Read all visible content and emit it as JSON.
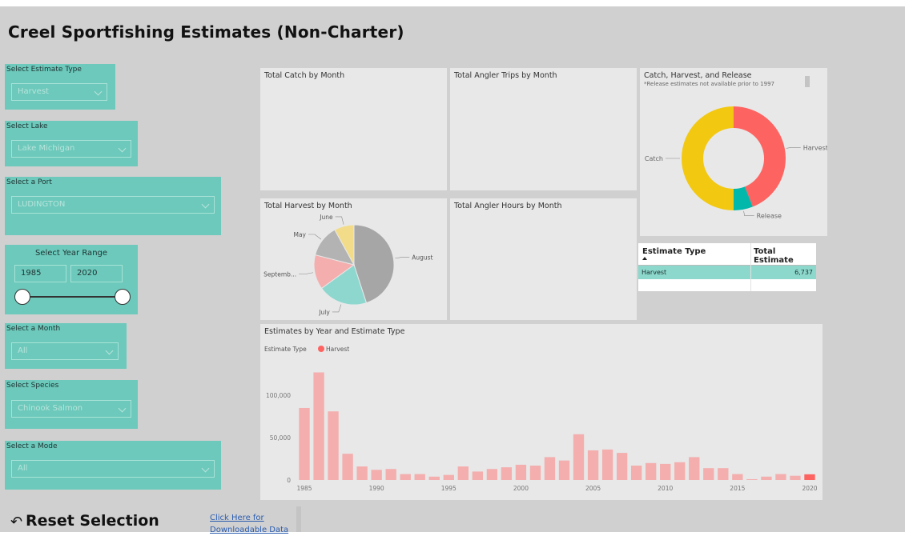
{
  "page": {
    "title": "Creel Sportfishing Estimates (Non-Charter)"
  },
  "colors": {
    "canvas": "#d0d0d0",
    "slicer": "#6cc9bb",
    "panel": "#e8e8e8",
    "harvest": "#fd6461",
    "catch": "#f2c811",
    "release": "#01b8aa",
    "bar": "#f4aeae"
  },
  "slicers": {
    "estimate_type": {
      "label": "Select Estimate Type",
      "value": "Harvest"
    },
    "lake": {
      "label": "Select Lake",
      "value": "Lake Michigan"
    },
    "port": {
      "label": "Select a Port",
      "value": "LUDINGTON"
    },
    "year_range": {
      "label": "Select Year Range",
      "from": "1985",
      "to": "2020"
    },
    "month": {
      "label": "Select a Month",
      "value": "All"
    },
    "species": {
      "label": "Select Species",
      "value": "Chinook Salmon"
    },
    "mode": {
      "label": "Select a Mode",
      "value": "All"
    }
  },
  "panels": {
    "catch_by_month": "Total Catch by Month",
    "trips_by_month": "Total Angler Trips by Month",
    "harvest_by_month": "Total Harvest by Month",
    "hours_by_month": "Total Angler Hours by Month",
    "chr": {
      "title": "Catch, Harvest, and Release",
      "note": "*Release estimates not available prior to 1997"
    },
    "estimates_by_year": "Estimates by Year and Estimate Type"
  },
  "table": {
    "headers": [
      "Estimate Type",
      "Total Estimate"
    ],
    "rows": [
      {
        "type": "Harvest",
        "total": "6,737"
      }
    ]
  },
  "footer": {
    "reset_label": "Reset Selection",
    "download_line1": "Click Here for",
    "download_line2": "Downloadable Data"
  },
  "chart_data": [
    {
      "type": "pie",
      "title": "Total Harvest by Month",
      "labels": [
        "August",
        "July",
        "Septemb...",
        "May",
        "June"
      ],
      "values": [
        45,
        20,
        14,
        13,
        8
      ],
      "colors": [
        "#a6a6a6",
        "#8ed7cf",
        "#f4aeae",
        "#b3b3b3",
        "#f2dc8a"
      ]
    },
    {
      "type": "pie",
      "title": "Catch, Harvest, and Release",
      "labels": [
        "Harvest",
        "Release",
        "Catch"
      ],
      "values": [
        44,
        6,
        50
      ],
      "colors": [
        "#fd6461",
        "#01b8aa",
        "#f2c811"
      ]
    },
    {
      "type": "bar",
      "title": "Estimates by Year and Estimate Type",
      "legend_title": "Estimate Type",
      "series": [
        {
          "name": "Harvest"
        }
      ],
      "categories": [
        1985,
        1986,
        1987,
        1988,
        1989,
        1990,
        1991,
        1992,
        1993,
        1994,
        1995,
        1996,
        1997,
        1998,
        1999,
        2000,
        2001,
        2002,
        2003,
        2004,
        2005,
        2006,
        2007,
        2008,
        2009,
        2010,
        2011,
        2012,
        2013,
        2014,
        2015,
        2016,
        2017,
        2018,
        2019,
        2020
      ],
      "values": [
        85000,
        127000,
        81000,
        31000,
        16000,
        12000,
        13000,
        7000,
        7000,
        4000,
        6000,
        16000,
        10000,
        13000,
        15000,
        18000,
        17000,
        27000,
        23000,
        54000,
        35000,
        36000,
        32000,
        17000,
        20000,
        19000,
        21000,
        27000,
        14000,
        14000,
        7000,
        1000,
        4000,
        7000,
        5000,
        6737
      ],
      "ytick_labels": [
        "0",
        "50,000",
        "100,000"
      ],
      "xtick_labels": [
        "1985",
        "1990",
        "1995",
        "2000",
        "2005",
        "2010",
        "2015",
        "2020"
      ],
      "ylim": [
        0,
        135000
      ]
    }
  ]
}
